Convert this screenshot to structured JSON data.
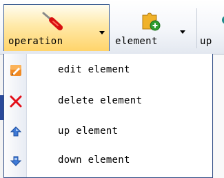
{
  "toolbar": {
    "operation": {
      "label": "operation",
      "icon": "screwdriver-icon"
    },
    "element": {
      "label": "element",
      "icon": "puzzle-add-icon"
    },
    "up": {
      "label": "up"
    }
  },
  "menu": {
    "items": [
      {
        "label": "edit element",
        "icon": "edit-icon"
      },
      {
        "label": "delete element",
        "icon": "delete-x-icon"
      },
      {
        "label": "up element",
        "icon": "arrow-up-icon"
      },
      {
        "label": "down element",
        "icon": "arrow-down-icon"
      }
    ]
  },
  "colors": {
    "active_button_top": "#fffdf0",
    "active_button_bottom": "#ffd46b",
    "menu_border": "#2f4d86",
    "delete_red": "#e3101a",
    "arrow_blue": "#3f7ad6"
  }
}
